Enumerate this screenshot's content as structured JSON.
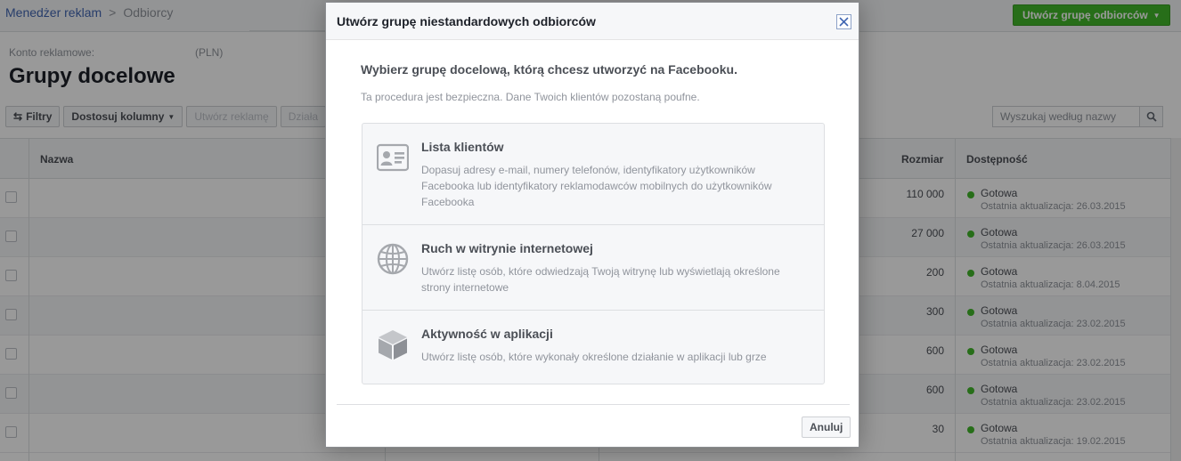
{
  "breadcrumb": {
    "root": "Menedżer reklam",
    "separator": ">",
    "current": "Odbiorcy"
  },
  "header": {
    "create_button": "Utwórz grupę odbiorców"
  },
  "account": {
    "label": "Konto reklamowe:",
    "currency": "(PLN)"
  },
  "page_title": "Grupy docelowe",
  "toolbar": {
    "filters": "Filtry",
    "columns": "Dostosuj kolumny",
    "create_ad": "Utwórz reklamę",
    "actions": "Działa"
  },
  "search": {
    "placeholder": "Wyszukaj według nazwy"
  },
  "table": {
    "headers": {
      "name": "Nazwa",
      "size": "Rozmiar",
      "availability": "Dostępność"
    },
    "rows": [
      {
        "size": "110 000",
        "status": "Gotowa",
        "updated": "Ostatnia aktualizacja: 26.03.2015"
      },
      {
        "size": "27 000",
        "status": "Gotowa",
        "updated": "Ostatnia aktualizacja: 26.03.2015"
      },
      {
        "size": "200",
        "status": "Gotowa",
        "updated": "Ostatnia aktualizacja: 8.04.2015"
      },
      {
        "size": "300",
        "status": "Gotowa",
        "updated": "Ostatnia aktualizacja: 23.02.2015"
      },
      {
        "size": "600",
        "status": "Gotowa",
        "updated": "Ostatnia aktualizacja: 23.02.2015"
      },
      {
        "size": "600",
        "status": "Gotowa",
        "updated": "Ostatnia aktualizacja: 23.02.2015"
      },
      {
        "size": "30",
        "status": "Gotowa",
        "updated": "Ostatnia aktualizacja: 19.02.2015"
      }
    ]
  },
  "modal": {
    "title": "Utwórz grupę niestandardowych odbiorców",
    "heading": "Wybierz grupę docelową, którą chcesz utworzyć na Facebooku.",
    "subtext": "Ta procedura jest bezpieczna. Dane Twoich klientów pozostaną poufne.",
    "options": [
      {
        "icon": "contact-card-icon",
        "title": "Lista klientów",
        "description": "Dopasuj adresy e-mail, numery telefonów, identyfikatory użytkowników Facebooka lub identyfikatory reklamodawców mobilnych do użytkowników Facebooka"
      },
      {
        "icon": "globe-icon",
        "title": "Ruch w witrynie internetowej",
        "description": "Utwórz listę osób, które odwiedzają Twoją witrynę lub wyświetlają określone strony internetowe"
      },
      {
        "icon": "cube-icon",
        "title": "Aktywność w aplikacji",
        "description": "Utwórz listę osób, które wykonały określone działanie w aplikacji lub grze"
      }
    ],
    "cancel": "Anuluj"
  }
}
